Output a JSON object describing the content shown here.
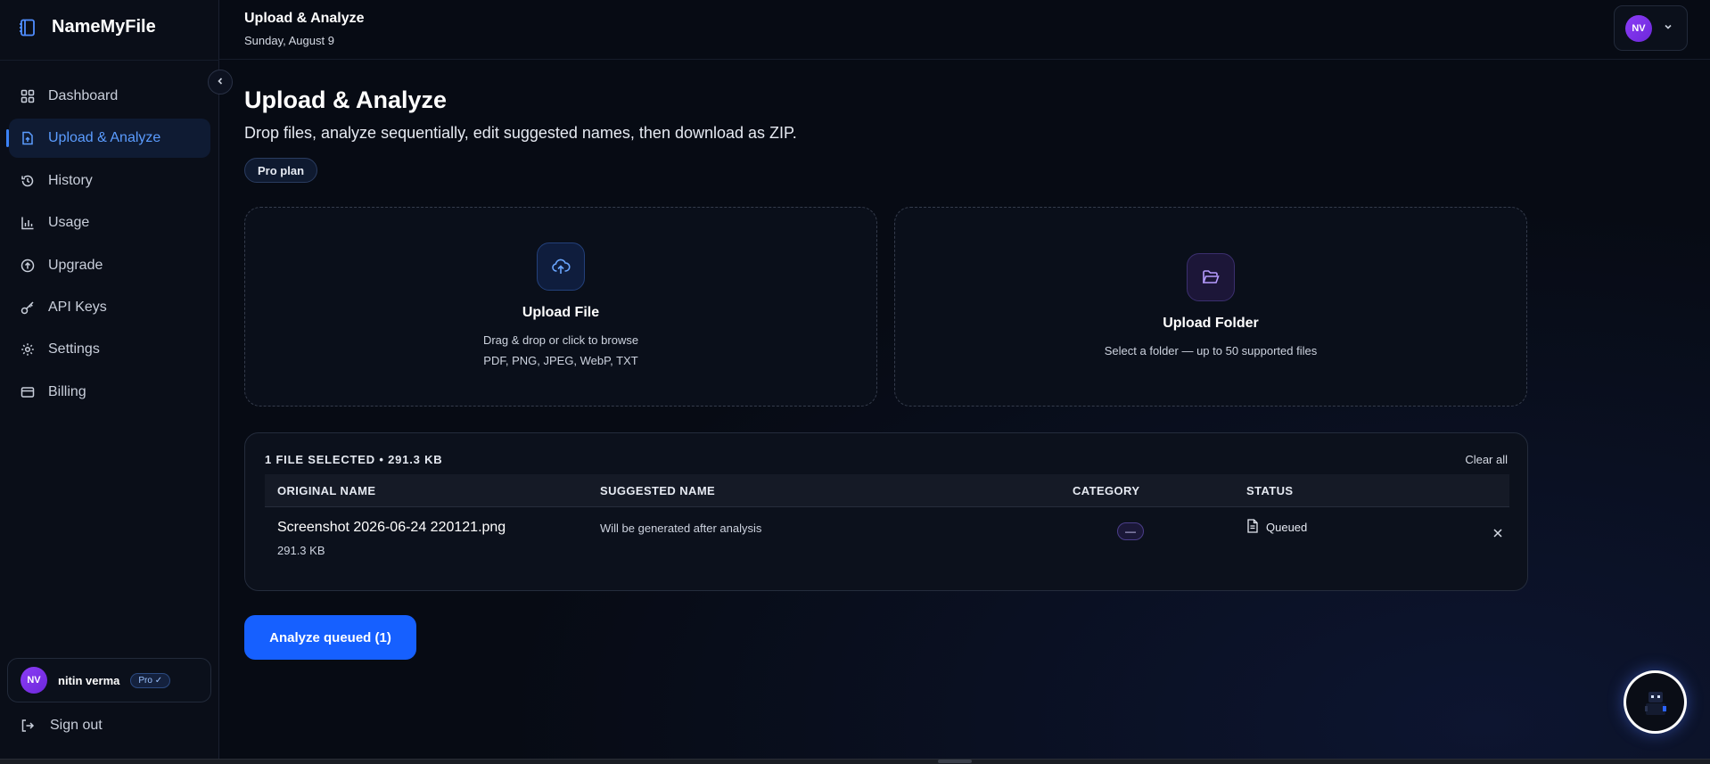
{
  "brand": {
    "name": "NameMyFile",
    "accent": "#3b82f6"
  },
  "sidebar": {
    "items": [
      {
        "label": "Dashboard",
        "icon": "grid-icon"
      },
      {
        "label": "Upload & Analyze",
        "icon": "file-upload-icon",
        "active": true
      },
      {
        "label": "History",
        "icon": "history-icon"
      },
      {
        "label": "Usage",
        "icon": "bar-chart-icon"
      },
      {
        "label": "Upgrade",
        "icon": "arrow-up-circle-icon"
      },
      {
        "label": "API Keys",
        "icon": "key-icon"
      },
      {
        "label": "Settings",
        "icon": "gear-icon"
      },
      {
        "label": "Billing",
        "icon": "credit-card-icon"
      }
    ],
    "user": {
      "initials": "NV",
      "name": "nitin verma",
      "badge": "Pro ✓"
    },
    "sign_out": "Sign out"
  },
  "header": {
    "title": "Upload & Analyze",
    "date": "Sunday, August 9",
    "avatar_initials": "NV"
  },
  "main": {
    "title": "Upload & Analyze",
    "subtitle": "Drop files, analyze sequentially, edit suggested names, then download as ZIP.",
    "plan": "Pro plan",
    "upload_file": {
      "title": "Upload File",
      "line1": "Drag & drop or click to browse",
      "line2": "PDF, PNG, JPEG, WebP, TXT"
    },
    "upload_folder": {
      "title": "Upload Folder",
      "line1": "Select a folder — up to 50 supported files"
    },
    "files": {
      "summary": "1 FILE SELECTED • 291.3 KB",
      "clear_all": "Clear all",
      "columns": [
        "ORIGINAL NAME",
        "SUGGESTED NAME",
        "CATEGORY",
        "STATUS"
      ],
      "rows": [
        {
          "name": "Screenshot 2026-06-24 220121.png",
          "size": "291.3 KB",
          "suggested": "Will be generated after analysis",
          "category": "—",
          "status": "Queued"
        }
      ]
    },
    "analyze_button": "Analyze queued (1)"
  }
}
